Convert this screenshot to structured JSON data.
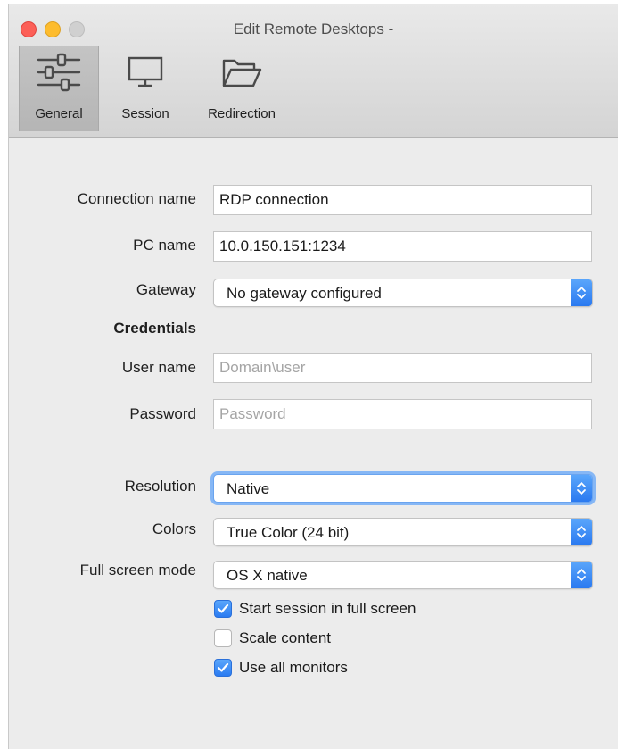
{
  "window": {
    "title": "Edit Remote Desktops -"
  },
  "tabs": [
    {
      "label": "General",
      "icon": "sliders-icon"
    },
    {
      "label": "Session",
      "icon": "monitor-icon"
    },
    {
      "label": "Redirection",
      "icon": "folder-icon"
    }
  ],
  "form": {
    "connection_name": {
      "label": "Connection name",
      "value": "RDP connection"
    },
    "pc_name": {
      "label": "PC name",
      "value": "10.0.150.151:1234"
    },
    "gateway": {
      "label": "Gateway",
      "value": "No gateway configured"
    },
    "credentials_heading": "Credentials",
    "user_name": {
      "label": "User name",
      "placeholder": "Domain\\user"
    },
    "password": {
      "label": "Password",
      "placeholder": "Password"
    },
    "resolution": {
      "label": "Resolution",
      "value": "Native"
    },
    "colors": {
      "label": "Colors",
      "value": "True Color (24 bit)"
    },
    "full_screen_mode": {
      "label": "Full screen mode",
      "value": "OS X native"
    },
    "checkboxes": [
      {
        "label": "Start session in full screen",
        "checked": true
      },
      {
        "label": "Scale content",
        "checked": false
      },
      {
        "label": "Use all monitors",
        "checked": true
      }
    ]
  },
  "colors": {
    "accent": "#2a79f0",
    "close": "#fc5f57",
    "minimize": "#fdbc2e",
    "zoom": "#d0d0d0"
  }
}
